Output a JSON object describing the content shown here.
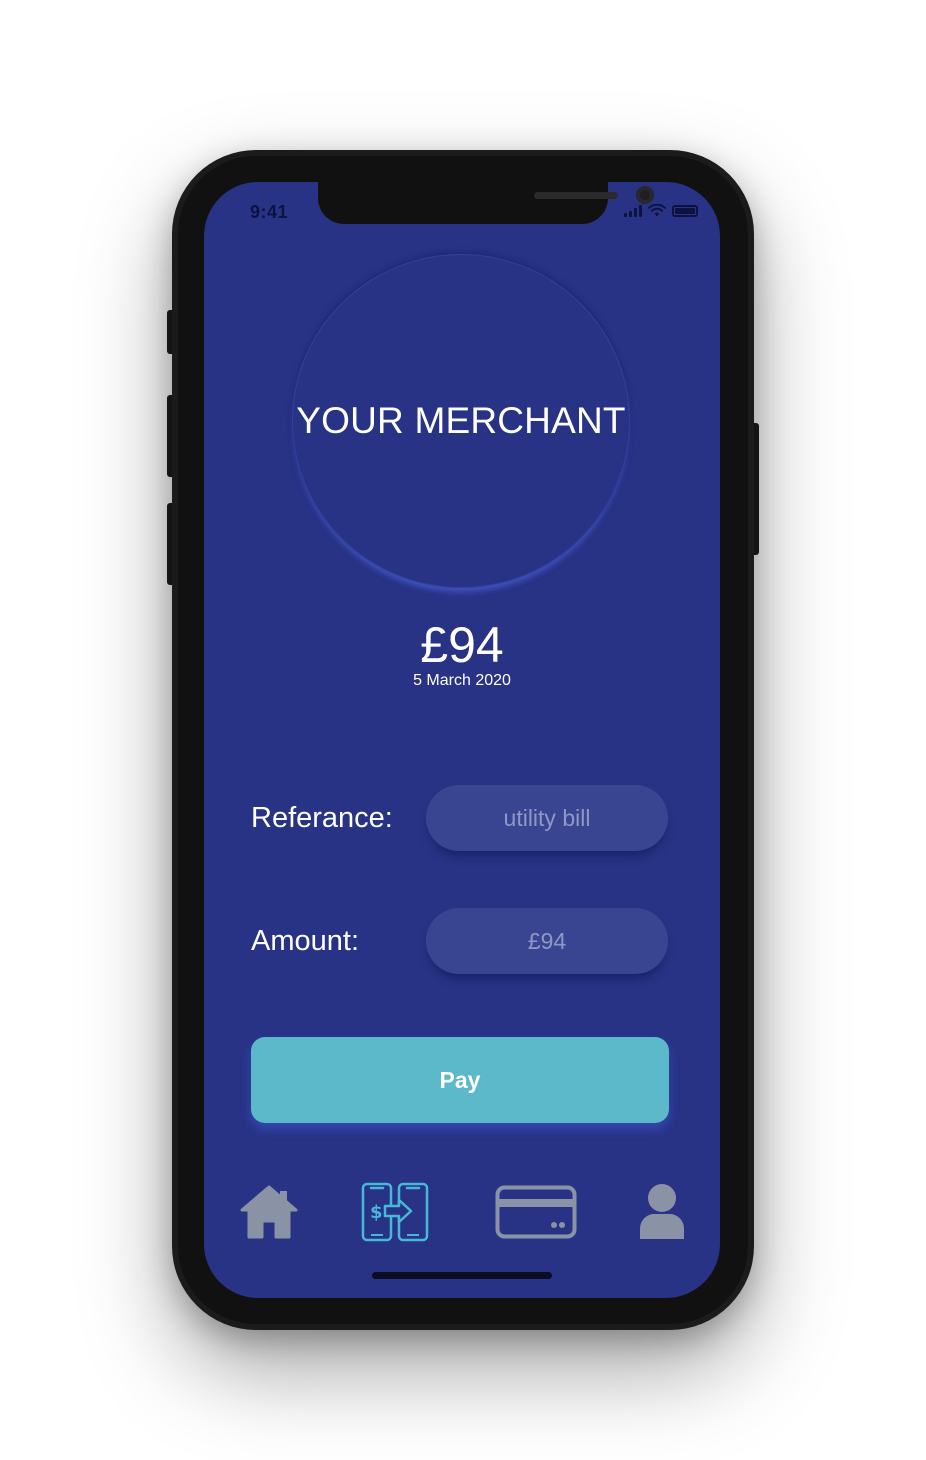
{
  "status_bar": {
    "time": "9:41"
  },
  "merchant": {
    "name": "YOUR MERCHANT"
  },
  "payment": {
    "amount": "£94",
    "date": "5 March 2020"
  },
  "form": {
    "reference_label": "Referance:",
    "reference_placeholder": "utility bill",
    "amount_label": "Amount:",
    "amount_placeholder": "£94"
  },
  "pay_button": {
    "label": "Pay"
  },
  "tabbar": {
    "items": [
      {
        "icon": "home-icon",
        "active": false
      },
      {
        "icon": "phone-transfer-icon",
        "active": true
      },
      {
        "icon": "credit-card-icon",
        "active": false
      },
      {
        "icon": "user-profile-icon",
        "active": false
      }
    ]
  },
  "colors": {
    "screen_bg": "#283386",
    "input_bg": "#3a4592",
    "pay_button": "#5bb9c9",
    "tab_inactive": "#8a93a6",
    "tab_active": "#48b8d8"
  }
}
